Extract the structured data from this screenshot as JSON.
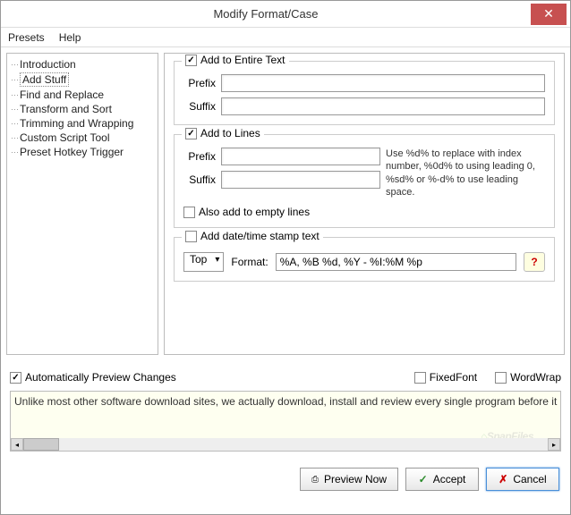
{
  "window": {
    "title": "Modify Format/Case"
  },
  "menu": {
    "presets": "Presets",
    "help": "Help"
  },
  "sidebar": {
    "items": [
      {
        "label": "Introduction",
        "selected": false
      },
      {
        "label": "Add Stuff",
        "selected": true
      },
      {
        "label": "Find and Replace",
        "selected": false
      },
      {
        "label": "Transform and Sort",
        "selected": false
      },
      {
        "label": "Trimming and Wrapping",
        "selected": false
      },
      {
        "label": "Custom Script Tool",
        "selected": false
      },
      {
        "label": "Preset Hotkey Trigger",
        "selected": false
      }
    ]
  },
  "groups": {
    "entire": {
      "legend": "Add to Entire Text",
      "checked": true,
      "prefix_label": "Prefix",
      "prefix_value": "",
      "suffix_label": "Suffix",
      "suffix_value": ""
    },
    "lines": {
      "legend": "Add to Lines",
      "checked": true,
      "prefix_label": "Prefix",
      "prefix_value": "",
      "suffix_label": "Suffix",
      "suffix_value": "",
      "hint": "Use %d% to replace with index number, %0d% to using leading 0, %sd% or %-d% to use leading space.",
      "empty_label": "Also add to empty lines",
      "empty_checked": false
    },
    "date": {
      "legend": "Add date/time stamp text",
      "checked": false,
      "position_label": "Top",
      "format_label": "Format:",
      "format_value": "%A, %B %d, %Y - %I:%M %p"
    }
  },
  "options": {
    "auto_preview": {
      "label": "Automatically Preview Changes",
      "checked": true
    },
    "fixed_font": {
      "label": "FixedFont",
      "checked": false
    },
    "word_wrap": {
      "label": "WordWrap",
      "checked": false
    }
  },
  "preview": {
    "text": "Unlike most other software download sites, we actually download, install and review every single program before it is listed on the sit",
    "watermark": "SnapFiles"
  },
  "buttons": {
    "preview": "Preview Now",
    "accept": "Accept",
    "cancel": "Cancel"
  }
}
